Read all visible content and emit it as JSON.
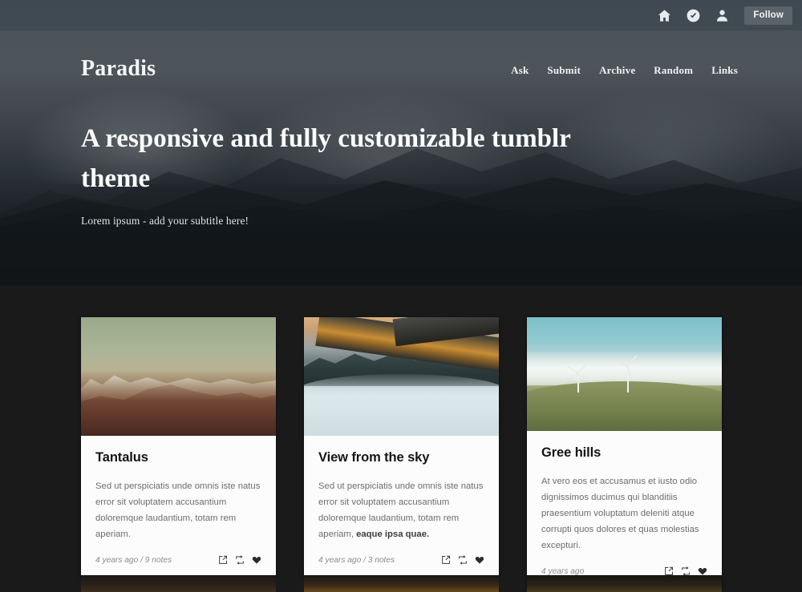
{
  "topbar": {
    "home_icon": "home-icon",
    "compose_icon": "compose-icon",
    "account_icon": "account-icon",
    "follow_label": "Follow"
  },
  "hero": {
    "brand": "Paradis",
    "headline": "A responsive and fully customizable tumblr theme",
    "subtitle": "Lorem ipsum - add your subtitle here!",
    "nav": [
      {
        "label": "Ask"
      },
      {
        "label": "Submit"
      },
      {
        "label": "Archive"
      },
      {
        "label": "Random"
      },
      {
        "label": "Links"
      }
    ]
  },
  "posts": [
    {
      "title": "Tantalus",
      "body_plain": "Sed ut perspiciatis unde omnis iste natus error sit voluptatem accusantium doloremque laudantium, totam rem aperiam.",
      "body_bold": "",
      "meta": "4 years ago / 9 notes",
      "photo": "sepia-mountain-landscape",
      "actions": [
        "share-icon",
        "reblog-icon",
        "heart-icon"
      ]
    },
    {
      "title": "View from the sky",
      "body_plain": "Sed ut perspiciatis unde omnis iste natus error sit voluptatem accusantium doloremque laudantium, totam rem aperiam, ",
      "body_bold": "eaque ipsa quae.",
      "meta": "4 years ago / 3 notes",
      "photo": "airplane-wing-above-clouds",
      "actions": [
        "share-icon",
        "reblog-icon",
        "heart-icon"
      ]
    },
    {
      "title": "Gree hills",
      "body_plain": "At vero eos et accusamus et iusto odio dignissimos ducimus qui blanditiis praesentium voluptatum deleniti atque corrupti quos dolores et quas molestias excepturi.",
      "body_bold": "",
      "meta": "4 years ago",
      "photo": "wind-turbines-on-green-hills",
      "actions": [
        "share-icon",
        "reblog-icon",
        "heart-icon"
      ]
    }
  ],
  "colors": {
    "topbar": "#3e4850",
    "page_background": "#1a1a1a",
    "card_background": "#fcfcfc",
    "title_text": "#141414",
    "body_text": "#6d6d6d",
    "meta_text": "#8c8c8c",
    "hero_text": "#fbfcfc"
  }
}
